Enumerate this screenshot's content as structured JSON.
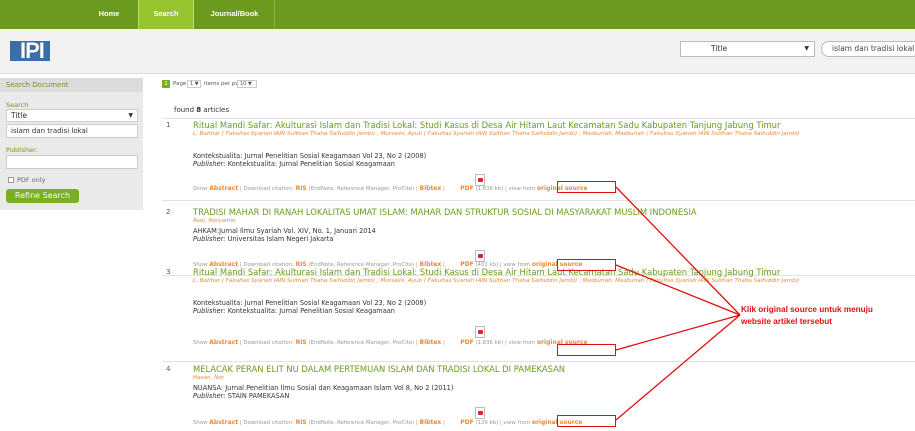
{
  "nav": {
    "items": [
      "Home",
      "Search",
      "Journal/Book"
    ],
    "active": "Search"
  },
  "header": {
    "logo_text": "IPI",
    "field_select": "Title",
    "query": "islam dan tradisi lokal"
  },
  "sidebar": {
    "title": "Search Document",
    "search_label": "Search",
    "field_select": "Title",
    "query": "islam dan tradisi lokal",
    "publisher_label": "Publisher:",
    "publisher_value": "",
    "pdf_only_label": "PDF only",
    "refine_button": "Refine Search"
  },
  "pager": {
    "current_page": "1",
    "page_label": "Page",
    "page_select": "1",
    "items_label": "items per page",
    "items_select": "10"
  },
  "results": {
    "found_prefix": "found ",
    "found_count": "8",
    "found_suffix": " articles"
  },
  "articles": [
    {
      "num": "1",
      "title": "Ritual Mandi Safar: Akulturasi Islam dan Tradisi Lokal: Studi Kasus di Desa Air Hitam Laut Kecamatan Sadu Kabupaten Tanjung Jabung Timur",
      "authors": "L, Bahtiar ( Fakultas Syariah IAIN Sulthan Thaha Saifuddin Jambi) ; Mursalin, Ayub ( Fakultas Syariah IAIN Sulthan Thaha Saifuddin Jambi) ; Masburiah, Masburiah ( Fakultas Syariah IAIN Sulthan Thaha Saifuddin Jambi)",
      "source": "Kontekstualita: Jurnal Penelitian Sosial Keagamaan Vol 23, No 2 (2008)",
      "publisher_label": "Publisher:",
      "publisher": "Kontekstualita: Jurnal Penelitian Sosial Keagamaan",
      "show": "Show",
      "abstract": "Abstract",
      "download": "| Download citation:",
      "ris": "RIS",
      "ris_note": "(EndNote, Reference Manager, ProCite) |",
      "bibtex": "Bibtex",
      "pdf": "PDF",
      "size": "(1.836 kb) | view from",
      "original": "original source"
    },
    {
      "num": "2",
      "title": "TRADISI MAHAR DI RANAH LOKALITAS UMAT ISLAM: MAHAR DAN STRUKTUR SOSIAL DI MASYARAKAT MUSLIM INDONESIA",
      "authors": "Asni, Noryamin",
      "source": "AHKAM:Jurnal Ilmu Syariah Vol. XIV, No. 1, Januari 2014",
      "publisher_label": "Publisher:",
      "publisher": "Universitas Islam Negeri Jakarta",
      "show": "Show",
      "abstract": "Abstract",
      "download": "| Download citation:",
      "ris": "RIS",
      "ris_note": "(EndNote, Reference Manager, ProCite) |",
      "bibtex": "Bibtex",
      "pdf": "PDF",
      "size": "(401 kb) | view from",
      "original": "original source"
    },
    {
      "num": "3",
      "title": "Ritual Mandi Safar: Akulturasi Islam dan Tradisi Lokal: Studi Kasus di Desa Air Hitam Laut Kecamatan Sadu Kabupaten Tanjung Jabung Timur",
      "authors": "L, Bahtiar ( Fakultas Syariah IAIN Sulthan Thaha Saifuddin Jambi) ; Mursalin, Ayub ( Fakultas Syariah IAIN Sulthan Thaha Saifuddin Jambi) ; Masburiah, Masburiah ( Fakultas Syariah IAIN Sulthan Thaha Saifuddin Jambi)",
      "source": "Kontekstualita: Jurnal Penelitian Sosial Keagamaan Vol 23, No 2 (2008)",
      "publisher_label": "Publisher:",
      "publisher": "Kontekstualita: Jurnal Penelitian Sosial Keagamaan",
      "show": "Show",
      "abstract": "Abstract",
      "download": "| Download citation:",
      "ris": "RIS",
      "ris_note": "(EndNote, Reference Manager, ProCite) |",
      "bibtex": "Bibtex",
      "pdf": "PDF",
      "size": "(1.836 kb) | view from",
      "original": "original source"
    },
    {
      "num": "4",
      "title": "MELACAK PERAN ELIT NU DALAM PERTEMUAN ISLAM DAN TRADISI LOKAL DI PAMEKASAN",
      "authors": "Hasan, Nor",
      "source": "NUANSA: Jurnal Penelitian Ilmu Sosial dan Keagamaan Islam Vol 8, No 2 (2011)",
      "publisher_label": "Publisher:",
      "publisher": "STAIN PAMEKASAN",
      "show": "Show",
      "abstract": "Abstract",
      "download": "| Download citation:",
      "ris": "RIS",
      "ris_note": "(EndNote, Reference Manager, ProCite) |",
      "bibtex": "Bibtex",
      "pdf": "PDF",
      "size": "(129 kb) | view from",
      "original": "original source"
    }
  ],
  "annotation": {
    "text": "Klik original source untuk menuju website artikel tersebut",
    "color": "#e01010"
  },
  "colors": {
    "nav_bg": "#6b9a1e",
    "accent_green": "#6b9a1e",
    "author_orange": "#e98a3a"
  }
}
